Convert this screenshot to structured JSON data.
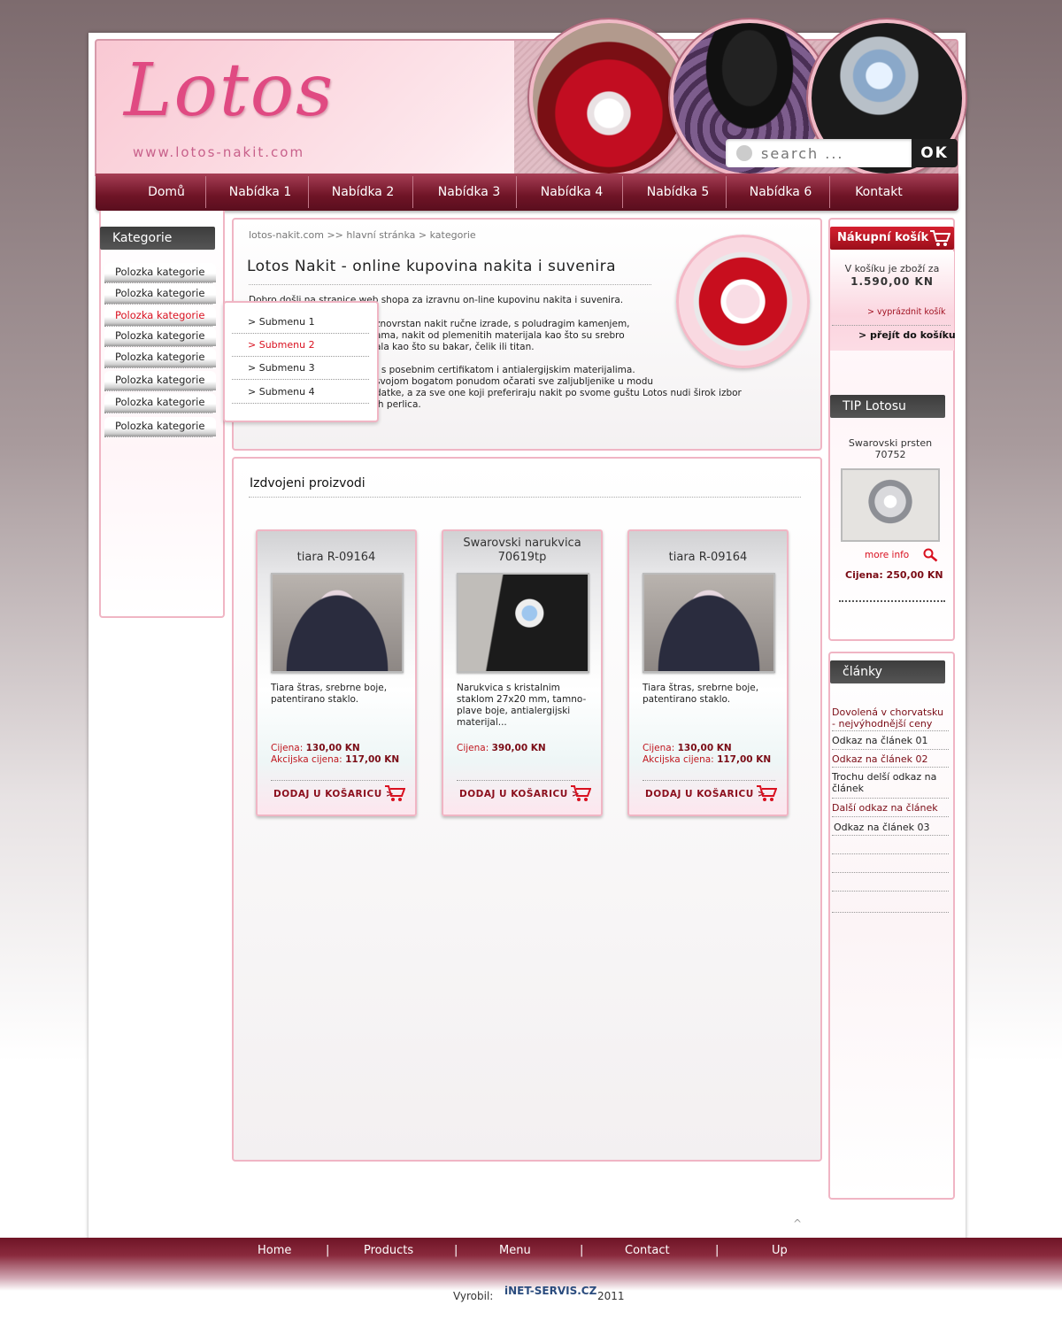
{
  "header": {
    "logo": "Lotos",
    "url": "www.lotos-nakit.com"
  },
  "search": {
    "placeholder": "search ...",
    "ok_label": "OK"
  },
  "nav": [
    "Domů",
    "Nabídka 1",
    "Nabídka 2",
    "Nabídka 3",
    "Nabídka 4",
    "Nabídka 5",
    "Nabídka 6",
    "Kontakt"
  ],
  "sidebar": {
    "title": "Kategorie",
    "items": [
      "Polozka kategorie",
      "Polozka kategorie",
      "Polozka kategorie",
      "Polozka kategorie",
      "Polozka kategorie",
      "Polozka kategorie",
      "Polozka kategorie",
      "Polozka kategorie"
    ],
    "active_index": 2
  },
  "submenu": {
    "items": [
      "> Submenu 1",
      "> Submenu 2",
      "> Submenu 3",
      "> Submenu 4"
    ],
    "active_index": 1
  },
  "breadcrumb": "lotos-nakit.com >> hlavní stránka > kategorie",
  "intro": {
    "title": "Lotos Nakit - online kupovina nakita i suvenira",
    "lines": [
      "Dobro došli na stranice web shopa za izravnu on-line kupovinu nakita i suvenira.",
      "znovrstan nakit ručne izrade, s poludragim kamenjem,",
      "ama, nakit od plemenitih materijala  kao što su srebro",
      "ala kao što su bakar, čelik ili titan.",
      ": s posebnim certifikatom i antialergijskim materijalima.",
      "svojom bogatom ponudom očarati sve zaljubljenike u modu",
      "datke, a za sve one koji preferiraju nakit po svome guštu Lotos nudi širok izbor",
      "ih perlica."
    ]
  },
  "featured": {
    "title": "Izdvojeni proizvodi",
    "products": [
      {
        "name": "tiara R-09164",
        "desc": "Tiara štras, srebrne boje, patentirano staklo.",
        "price_label": "Cijena:",
        "price": "130,00 KN",
        "sale_label": "Akcijska cijena:",
        "sale_price": "117,00 KN",
        "cart": "DODAJ U KOŠARICU >"
      },
      {
        "name": "Swarovski narukvica 70619tp",
        "desc": "Narukvica s kristalnim staklom 27x20 mm, tamno-plave boje, antialergijski materijal...",
        "price_label": "Cijena:",
        "price": "390,00 KN",
        "cart": "DODAJ U KOŠARICU >"
      },
      {
        "name": "tiara R-09164",
        "desc": "Tiara štras, srebrne boje, patentirano staklo.",
        "price_label": "Cijena:",
        "price": "130,00 KN",
        "sale_label": "Akcijska cijena:",
        "sale_price": "117,00 KN",
        "cart": "DODAJ U KOŠARICU >"
      }
    ]
  },
  "cart": {
    "title": "Nákupní košík",
    "text": "V košíku je zboží za",
    "total": "1.590,00 KN",
    "empty": "> vyprázdnit košík",
    "checkout": "> přejít do košíku"
  },
  "tip": {
    "title": "TIP Lotosu",
    "name": "Swarovski prsten 70752",
    "more": "more info",
    "price": "Cijena: 250,00 KN"
  },
  "articles": {
    "title": "články",
    "items": [
      "Dovolená v chorvatsku - nejvýhodnější ceny",
      "Odkaz na článek 01",
      "Odkaz na článek 02",
      "Trochu delší odkaz na článek",
      "Další odkaz na článek",
      "Odkaz na článek 03"
    ]
  },
  "footer": {
    "links": [
      "Home",
      "Products",
      "Menu",
      "Contact",
      "Up"
    ],
    "credit_prefix": "Vyrobil:",
    "brand": "iNET-SERVIS.CZ",
    "year": "2011",
    "top_mark": "^"
  }
}
